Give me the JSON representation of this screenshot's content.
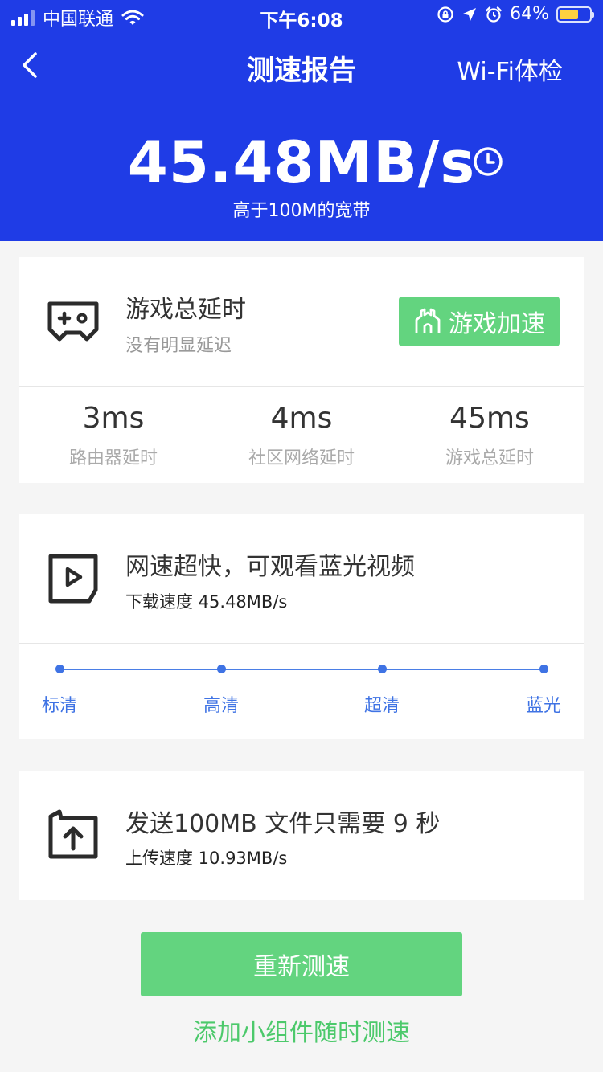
{
  "status_bar": {
    "carrier": "中国联通",
    "time": "下午6:08",
    "battery_percent": "64%",
    "battery_level": 0.64,
    "icons": [
      "signal-icon",
      "wifi-icon",
      "rotation-lock-icon",
      "location-icon",
      "alarm-icon",
      "battery-icon"
    ]
  },
  "nav": {
    "back_icon": "chevron-left-icon",
    "title": "测速报告",
    "right_action": "Wi-Fi体检"
  },
  "summary": {
    "speed": "45.48MB/s",
    "history_icon": "clock-icon",
    "subtitle": "高于100M的宽带"
  },
  "game_card": {
    "icon": "gamepad-icon",
    "title": "游戏总延时",
    "subtitle": "没有明显延迟",
    "button_label": "游戏加速",
    "button_icon": "castle-icon",
    "stats": [
      {
        "value": "3ms",
        "label": "路由器延时"
      },
      {
        "value": "4ms",
        "label": "社区网络延时"
      },
      {
        "value": "45ms",
        "label": "游戏总延时"
      }
    ]
  },
  "video_card": {
    "icon": "video-play-icon",
    "title": "网速超快，可观看蓝光视频",
    "subtitle": "下载速度 45.48MB/s",
    "levels": [
      "标清",
      "高清",
      "超清",
      "蓝光"
    ]
  },
  "upload_card": {
    "icon": "folder-upload-icon",
    "title": "发送100MB 文件只需要 9 秒",
    "subtitle": "上传速度 10.93MB/s"
  },
  "actions": {
    "retest_label": "重新测速",
    "widget_label": "添加小组件随时测速"
  },
  "colors": {
    "header_bg": "#1f3ce6",
    "accent_green": "#63d47f",
    "level_blue": "#3f73e4",
    "battery_yellow": "#ffd23f"
  }
}
